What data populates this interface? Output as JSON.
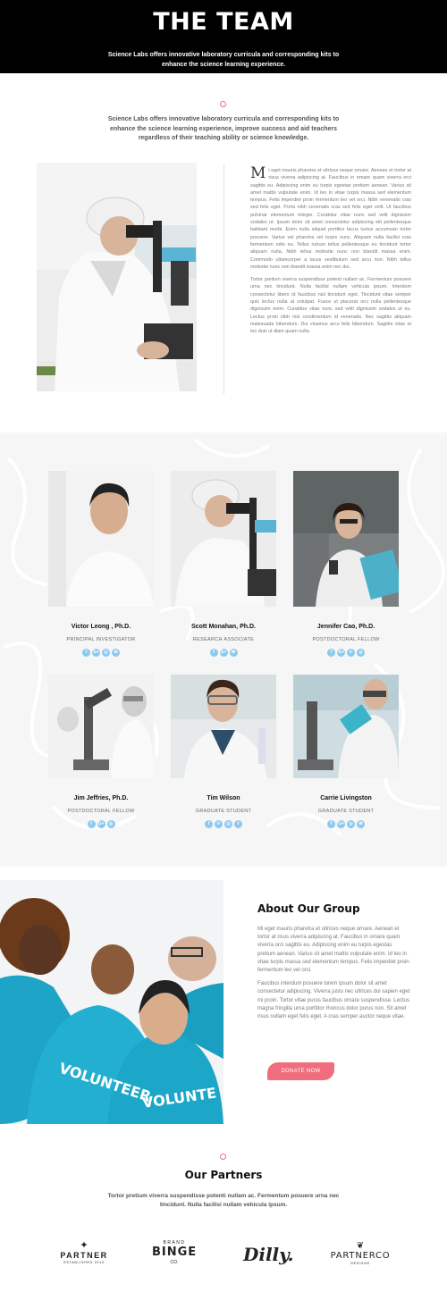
{
  "hero": {
    "title": "THE TEAM",
    "subtitle": "Science Labs offers innovative laboratory curricula and corresponding kits to enhance the science learning experience."
  },
  "intro": {
    "text": "Science Labs offers innovative laboratory curricula and corresponding kits to enhance the science learning experience, improve success and aid teachers regardless of their teaching ability or science knowledge."
  },
  "article": {
    "dropcap": "M",
    "para1": "i eget mauris pharetra et ultrices neque ornare. Aenean et tortor at risus viverra adipiscing at. Faucibus in ornare quam viverra orci sagittis eu. Adipiscing enim eu turpis egestas pretium aenean. Varius sit amet mattis vulputate enim. Id leo in vitae turpis massa sed elementum tempus. Felis imperdiet proin fermentum leo vel orci. Nibh venenatis cras sed felis eget. Porta nibh venenatis cras sed felis eget velit. Ut faucibus pulvinar elementum integer. Curabitur vitae nunc sed velit dignissim sodales ut. Ipsum dolor sit amet consectetur adipiscing elit pellentesque habitant morbi. Enim nulla aliquet porttitor lacus luctus accumsan tortor posuere. Varius vel pharetra vel turpis nunc. Aliquam nulla facilisi cras fermentum odio eu. Tellus rutrum tellus pellentesque eu tincidunt tortor aliquam nulla. Nibh tellus molestie nunc non blandit massa enim. Commodo ullamcorper a lacus vestibulum sed arcu non. Nibh tellus molestie nunc non blandit massa enim nec dui.",
    "para2": "Tortor pretium viverra suspendisse potenti nullam ac. Fermentum posuere urna nec tincidunt. Nulla facilisi nullam vehicula ipsum. Interdum consectetur libero id faucibus nisl tincidunt eget. Tincidunt vitae semper quis lectus nulla at volutpat. Fusce ut placerat orci nulla pellentesque dignissim enim. Curabitur vitae nunc sed velit dignissim sodales ut eu. Lectus proin nibh nisl condimentum id venenatis. Nec sagittis aliquam malesuada bibendum. Dui vivamus arcu felis bibendum. Sagittis vitae et leo duis ut diam quam nulla."
  },
  "team": [
    {
      "name": "Victor Leong , Ph.D.",
      "role": "PRINCIPAL INVESTIGATOR",
      "socials": [
        "f",
        "G+",
        "◎",
        "✉"
      ]
    },
    {
      "name": "Scott Monahan, Ph.D.",
      "role": "RESEARCH ASSOCIATE",
      "socials": [
        "f",
        "G+",
        "✉"
      ]
    },
    {
      "name": "Jennifer Cao, Ph.D.",
      "role": "POSTDOCTORAL FELLOW",
      "socials": [
        "f",
        "G+",
        "℗",
        "◎"
      ]
    },
    {
      "name": "Jim Jeffries, Ph.D.",
      "role": "POSTDOCTORAL FELLOW",
      "socials": [
        "f",
        "G+",
        "◎"
      ]
    },
    {
      "name": "Tim Wilson",
      "role": "GRADUATE STUDENT",
      "socials": [
        "f",
        "℗",
        "◎",
        "t"
      ]
    },
    {
      "name": "Carrie Livingston",
      "role": "GRADUATE STUDENT",
      "socials": [
        "f",
        "G+",
        "◎",
        "✉"
      ]
    }
  ],
  "about": {
    "title": "About Our Group",
    "para1": "Mi eget mauris pharetra et ultrices neque ornare. Aenean et tortor at risus viverra adipiscing at. Faucibus in ornare quam viverra orci sagittis eu. Adipiscing enim eu turpis egestas pretium aenean. Varius sit amet mattis vulputate enim. Id leo in vitae turpis massa sed elementum tempus. Felis imperdiet proin fermentum leo vel orci.",
    "para2": "Faucibus interdum posuere lorem ipsum dolor sit amet consectetur adipiscing. Viverra justo nec ultrices dui sapien eget mi proin. Tortor vitae purus faucibus ornare suspendisse. Lectus magna fringilla urna porttitor rhoncus dolor purus non. Sit amet risus nullam eget felis eget. A cras semper auctor neque vitae.",
    "button": "DONATE NOW"
  },
  "partners": {
    "title": "Our Partners",
    "text": "Tortor pretium viverra suspendisse potenti nullam ac. Fermentum posuere urna nec tincidunt. Nulla facilisi nullam vehicula ipsum.",
    "logos": [
      {
        "main": "PARTNER",
        "sub": "ESTABLISHED 2019"
      },
      {
        "top": "BRAND",
        "main": "BINGE",
        "sub": "CO."
      },
      {
        "main": "Dilly."
      },
      {
        "main": "PARTNERCO",
        "sub": "DESIGNS"
      }
    ]
  },
  "colors": {
    "accent": "#ef6d7d",
    "social": "#8cc9ee",
    "hero_bg": "#000000",
    "team_bg": "#f6f6f6"
  }
}
